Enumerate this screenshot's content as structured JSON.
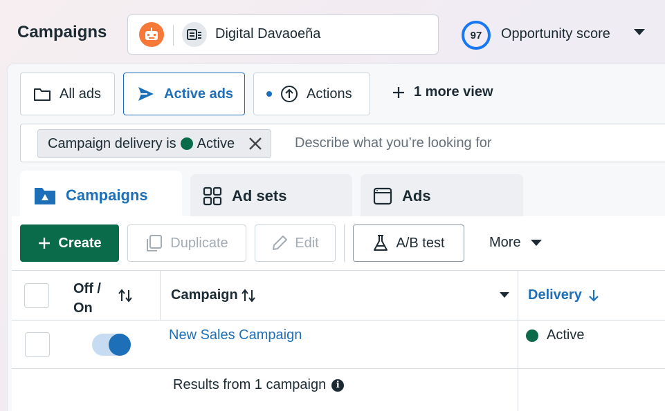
{
  "header": {
    "title": "Campaigns",
    "account_name": "Digital Davaoeña",
    "opportunity_score": "97",
    "opportunity_label": "Opportunity score"
  },
  "views": {
    "all_ads": "All ads",
    "active_ads": "Active ads",
    "actions": "Actions",
    "more_view": "1 more view"
  },
  "filter": {
    "chip_label": "Campaign delivery is",
    "chip_value": "Active",
    "placeholder": "Describe what you’re looking for"
  },
  "level_tabs": {
    "campaigns": "Campaigns",
    "ad_sets": "Ad sets",
    "ads": "Ads"
  },
  "toolbar": {
    "create": "Create",
    "duplicate": "Duplicate",
    "edit": "Edit",
    "ab_test": "A/B test",
    "more": "More"
  },
  "table": {
    "col_off_on_1": "Off /",
    "col_off_on_2": "On",
    "col_campaign": "Campaign",
    "col_delivery": "Delivery",
    "rows": [
      {
        "name": "New Sales Campaign",
        "toggle_on": true,
        "delivery": "Active"
      }
    ],
    "footer": "Results from 1 campaign"
  },
  "colors": {
    "brand_blue": "#1d6fb8",
    "create_green": "#0a6b4a",
    "active_green": "#0a6b4a"
  },
  "icons": [
    "robot-avatar-icon",
    "page-icon",
    "folder-icon",
    "send-icon",
    "upload-circle-icon",
    "plus-icon",
    "x-icon",
    "folder-filled-icon",
    "grid-icon",
    "window-icon",
    "duplicate-icon",
    "pencil-icon",
    "flask-icon",
    "sort-icon",
    "arrow-down-icon",
    "info-icon"
  ]
}
